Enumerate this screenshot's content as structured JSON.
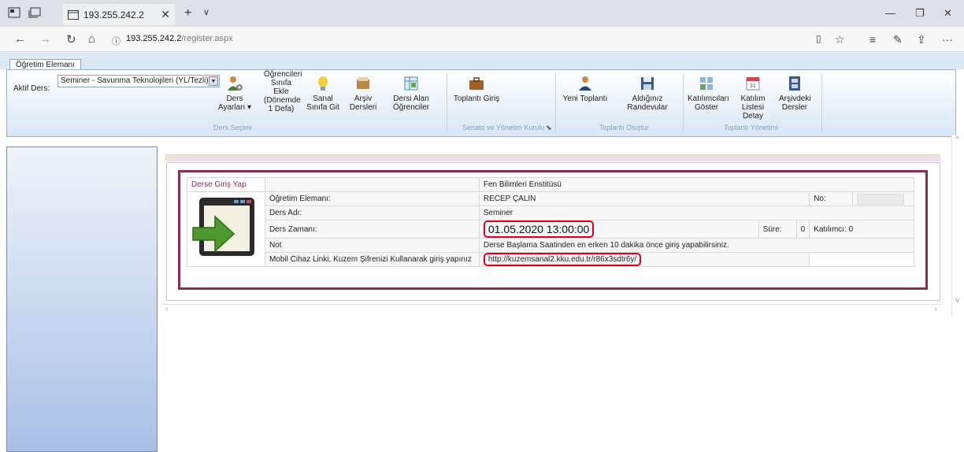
{
  "browser": {
    "tab_title": "193.255.242.2",
    "url_host": "193.255.242.2",
    "url_path": "/register.aspx"
  },
  "ribbon": {
    "tab_label": "Öğretim Elemanı",
    "aktif_ders_label": "Aktif Ders:",
    "aktif_ders_value": "Seminer - Savunma Teknolojileri (YL/Tezli)",
    "buttons": {
      "ders_ayarlari": "Ders Ayarları ▾",
      "ogrencileri_ekle": "Öğrencileri Sınıfa Ekle (Dönemde 1 Defa)",
      "sanal_sinifa_git": "Sanal Sınıfa Git",
      "arsiv_dersleri": "Arşiv Dersleri",
      "dersi_alan_ogrenciler": "Dersi Alan Öğrenciler",
      "toplanti_giris": "Toplantı Giriş",
      "yeni_toplanti": "Yeni Toplantı",
      "aldiginiz_randevular": "Aldığınız Randevular",
      "katilimcilari_goster": "Katılımcıları Göster",
      "katilim_listesi": "Katılım Listesi Detay",
      "arsivdeki_dersler": "Arşivdeki Dersler"
    },
    "groups": {
      "ders_secimi": "Ders Seçimi",
      "senato": "Senato ve Yönetim Kurulu",
      "toplanti_olustur": "Toplantı Oluştur",
      "toplanti_yonetimi": "Toplantı Yönetimi"
    }
  },
  "info": {
    "derse_giris": "Derse Giriş Yap",
    "enstitu": "Fen Bilimleri Enstitüsü",
    "ogretim_elemani_label": "Öğretim Elemanı:",
    "ogretim_elemani_value": "RECEP ÇALIN",
    "no_label": "No:",
    "ders_adi_label": "Ders Adı:",
    "ders_adi_value": "Seminer",
    "ders_zamani_label": "Ders Zamanı:",
    "ders_zamani_value": "01.05.2020 13:00:00",
    "sure_label": "Süre:",
    "sure_value": "0",
    "katilimci_label": "Katılımcı:",
    "katilimci_value": "0",
    "not_label": "Not",
    "not_value": "Derse Başlama Saatinden en erken 10 dakika önce giriş yapabilirsiniz.",
    "mobil_label": "Mobil Cihaz Linki, Kuzem Şifrenizi Kullanarak giriş yapınız",
    "mobil_link": "http://kuzemsanal2.kku.edu.tr/r86x3sdtr6y/"
  },
  "colors": {
    "accent": "#8c2c55",
    "highlight": "#e0001a"
  }
}
